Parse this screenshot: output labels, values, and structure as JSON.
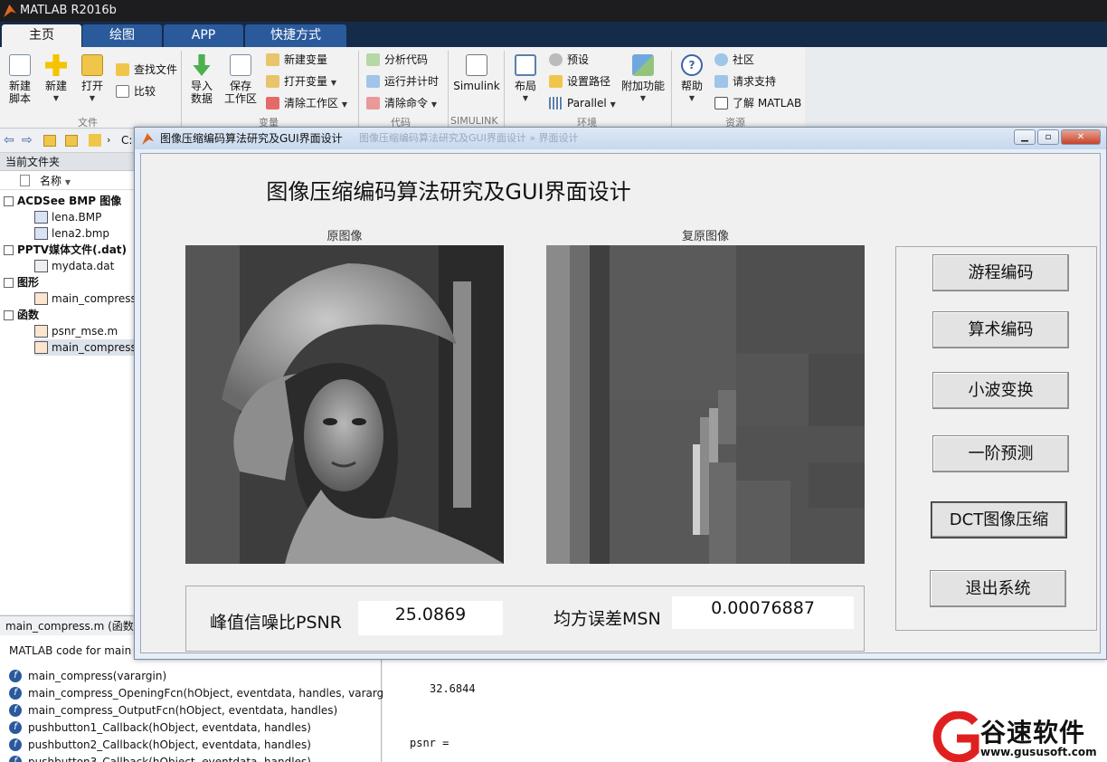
{
  "app": {
    "title": "MATLAB R2016b"
  },
  "tabs": [
    {
      "label": "主页",
      "active": true
    },
    {
      "label": "绘图"
    },
    {
      "label": "APP"
    },
    {
      "label": "快捷方式"
    }
  ],
  "ribbon": {
    "file": {
      "group": "文件",
      "new_script": [
        "新建",
        "脚本"
      ],
      "new": "新建",
      "open": "打开",
      "find_files": "查找文件",
      "compare": "比较"
    },
    "variable": {
      "group": "变量",
      "import": [
        "导入",
        "数据"
      ],
      "save": [
        "保存",
        "工作区"
      ],
      "new_var": "新建变量",
      "open_var": "打开变量",
      "clear_ws": "清除工作区"
    },
    "code": {
      "group": "代码",
      "analyze": "分析代码",
      "run_time": "运行并计时",
      "clear_cmd": "清除命令"
    },
    "simulink": {
      "group": "SIMULINK",
      "label": "Simulink"
    },
    "env": {
      "group": "环境",
      "layout": "布局",
      "prefs": "预设",
      "set_path": "设置路径",
      "parallel": "Parallel",
      "addons": "附加功能"
    },
    "resources": {
      "group": "资源",
      "help": "帮助",
      "community": "社区",
      "support": "请求支持",
      "learn": "了解 MATLAB"
    }
  },
  "path": {
    "drive": "C:"
  },
  "current_folder": {
    "title": "当前文件夹",
    "col_name": "名称",
    "groups": [
      {
        "label": "ACDSee BMP 图像",
        "files": [
          "lena.BMP",
          "lena2.bmp"
        ]
      },
      {
        "label": "PPTV媒体文件(.dat)",
        "files": [
          "mydata.dat"
        ]
      },
      {
        "label": "图形",
        "files": [
          "main_compress"
        ]
      },
      {
        "label": "函数",
        "files": [
          "psnr_mse.m",
          "main_compress"
        ]
      }
    ]
  },
  "details": {
    "header": "main_compress.m  (函数",
    "description": "MATLAB code for main",
    "functions": [
      "main_compress(varargin)",
      "main_compress_OpeningFcn(hObject, eventdata, handles, vararg...",
      "main_compress_OutputFcn(hObject, eventdata, handles)",
      "pushbutton1_Callback(hObject, eventdata, handles)",
      "pushbutton2_Callback(hObject, eventdata, handles)",
      "pushbutton3_Callback(hObject, eventdata, handles)"
    ]
  },
  "command_window": {
    "value_line": "32.6844",
    "prompt_line": "psnr ="
  },
  "gui": {
    "window_title": "图像压缩编码算法研究及GUI界面设计",
    "ghost_title": "图像压缩编码算法研究及GUI界面设计 » 界面设计",
    "heading": "图像压缩编码算法研究及GUI界面设计",
    "original_label": "原图像",
    "restored_label": "复原图像",
    "buttons": [
      "游程编码",
      "算术编码",
      "小波变换",
      "一阶预测",
      "DCT图像压缩",
      "退出系统"
    ],
    "psnr_label": "峰值信噪比PSNR",
    "psnr_value": "25.0869",
    "mse_label": "均方误差MSN",
    "mse_value": "0.00076887"
  },
  "watermark": {
    "brand": "谷速软件",
    "url": "www.gususoft.com"
  }
}
